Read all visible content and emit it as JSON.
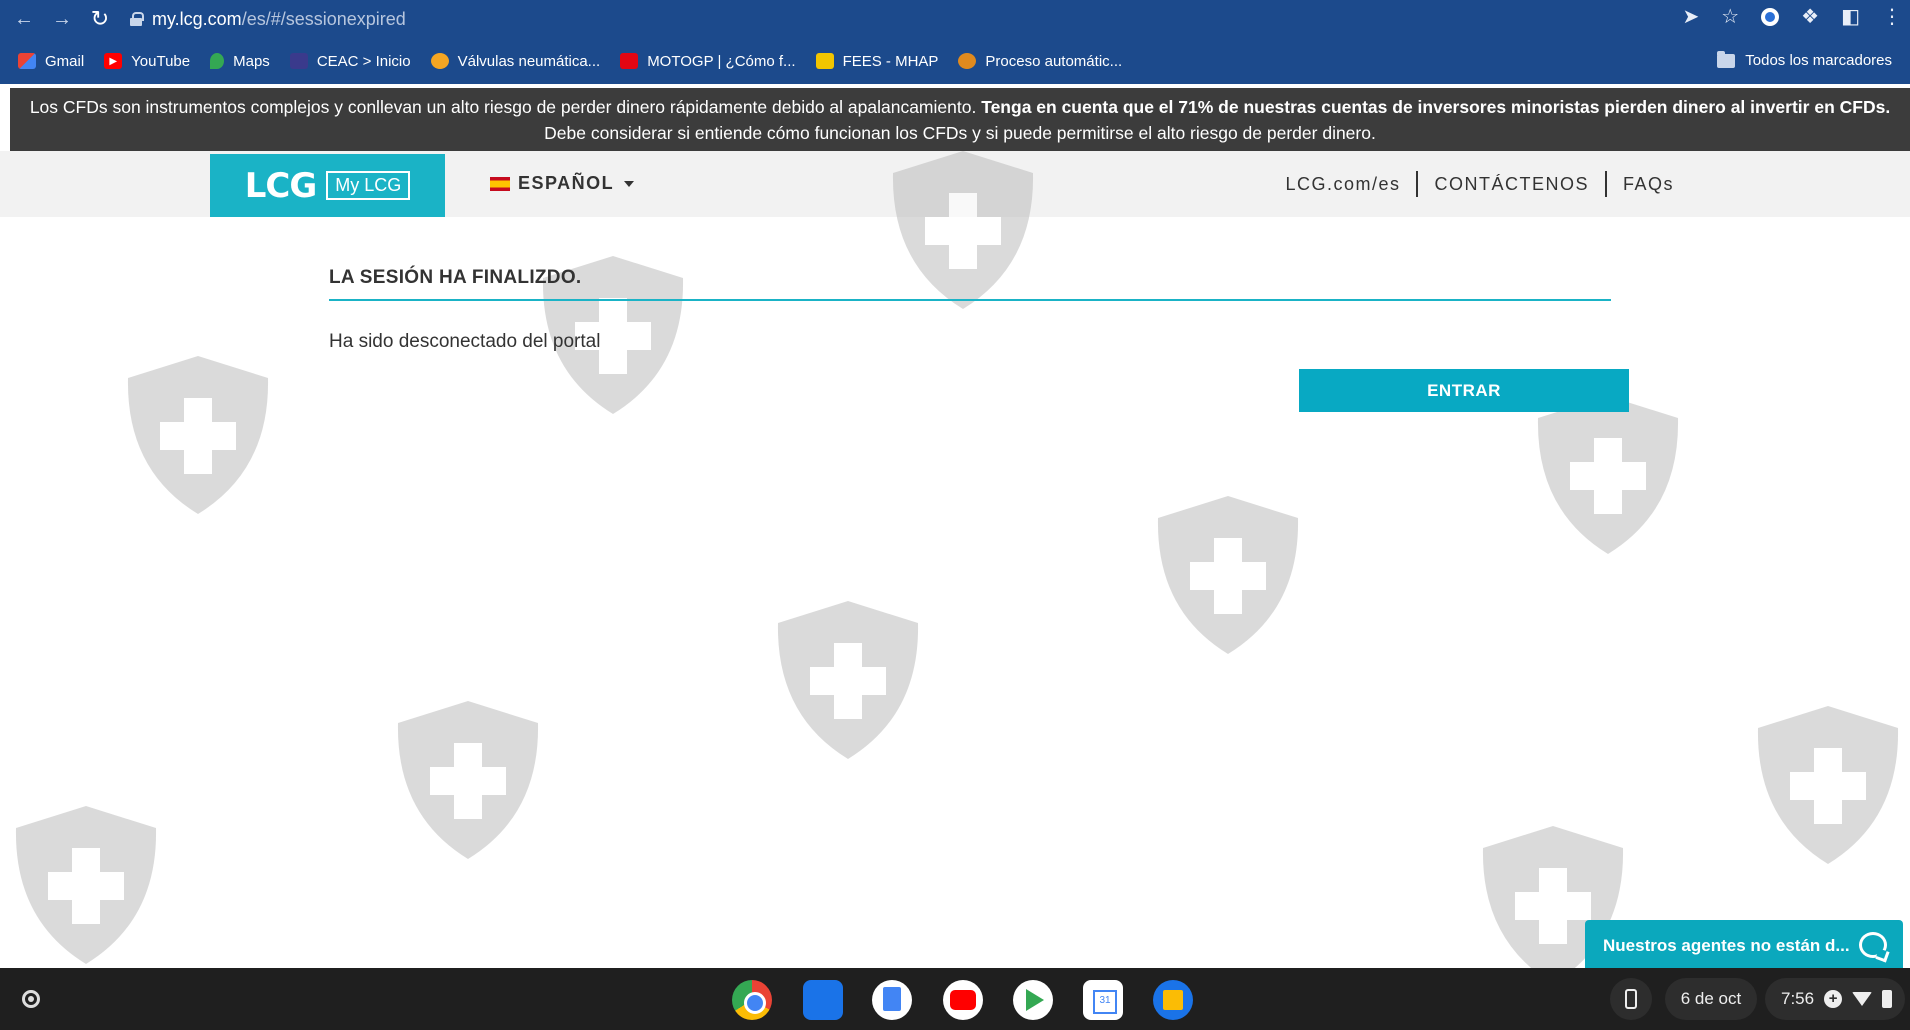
{
  "browser": {
    "url_host": "my.lcg.com",
    "url_path": "/es/#/sessionexpired",
    "bookmarks": [
      {
        "label": "Gmail",
        "icon": "gmail-icon"
      },
      {
        "label": "YouTube",
        "icon": "youtube-icon"
      },
      {
        "label": "Maps",
        "icon": "maps-icon"
      },
      {
        "label": "CEAC > Inicio",
        "icon": "ceac-icon"
      },
      {
        "label": "Válvulas neumática...",
        "icon": "valvulas-icon"
      },
      {
        "label": "MOTOGP | ¿Cómo f...",
        "icon": "as-icon"
      },
      {
        "label": "FEES - MHAP",
        "icon": "fees-icon"
      },
      {
        "label": "Proceso automátic...",
        "icon": "proceso-icon"
      }
    ],
    "all_bookmarks_label": "Todos los marcadores"
  },
  "banner": {
    "text_plain": "Los CFDs son instrumentos complejos y conllevan un alto riesgo de perder dinero rápidamente debido al apalancamiento. ",
    "text_bold": "Tenga en cuenta que el 71% de nuestras cuentas de inversores minoristas pierden dinero al invertir en CFDs.",
    "text_tail": " Debe considerar si entiende cómo funcionan los CFDs y si puede permitirse el alto riesgo de perder dinero."
  },
  "header": {
    "logo_main": "LCG",
    "logo_sub": "My LCG",
    "language": "ESPAÑOL",
    "links": [
      "LCG.com/es",
      "CONTÁCTENOS",
      "FAQs"
    ]
  },
  "content": {
    "title": "LA SESIÓN HA FINALIZDO.",
    "message": "Ha sido desconectado del portal",
    "enter_button": "ENTRAR"
  },
  "chat": {
    "label": "Nuestros agentes no están d..."
  },
  "shelf": {
    "date": "6 de oct",
    "time": "7:56"
  },
  "colors": {
    "chrome_blue": "#1c4a8c",
    "brand_teal": "#1ab3c6",
    "button_teal": "#08a9c3",
    "banner_dark": "#3c3c3c"
  }
}
